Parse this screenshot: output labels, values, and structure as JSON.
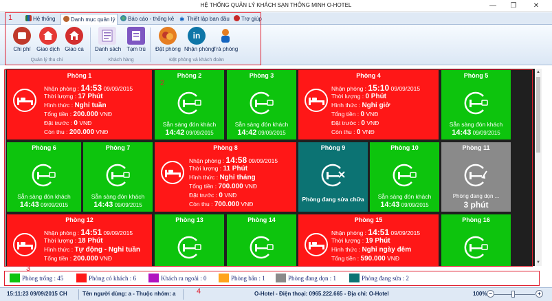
{
  "window": {
    "title": "HỆ THỐNG QUẢN LÝ KHÁCH SẠN THÔNG MINH O-HOTEL",
    "min_glyph": "—",
    "max_glyph": "❐",
    "close_glyph": "✕"
  },
  "ribbon": {
    "tabs": [
      {
        "label": "Hệ thống",
        "icon": "chart-icon",
        "color": "#c0392b"
      },
      {
        "label": "Danh mục quản lý",
        "icon": "user-icon",
        "color": "#b8632e",
        "active": true
      },
      {
        "label": "Báo cáo - thống kê",
        "icon": "globe-icon",
        "color": "#2e7d32"
      },
      {
        "label": "Thiết lập ban đầu",
        "icon": "gear-icon",
        "color": "#1565c0"
      },
      {
        "label": "Trợ giúp",
        "icon": "help-icon",
        "color": "#c62828"
      }
    ],
    "buttons": [
      {
        "label": "Chi phí",
        "icon": "expense-icon",
        "color": "#c0392b"
      },
      {
        "label": "Giao dịch",
        "icon": "transaction-icon",
        "color": "#e53935"
      },
      {
        "label": "Giao ca",
        "icon": "shift-icon",
        "color": "#d32f2f"
      },
      {
        "label": "Danh sách",
        "icon": "list-icon",
        "color": "#8e6bbf"
      },
      {
        "label": "Tạm trú",
        "icon": "residence-icon",
        "color": "#7e57c2"
      },
      {
        "label": "Đặt phòng",
        "icon": "booking-icon",
        "color": "#e67e22"
      },
      {
        "label": "Nhận phòng",
        "icon": "checkin-icon",
        "color": "#0e76a8"
      },
      {
        "label": "Trả phòng",
        "icon": "checkout-icon",
        "color": "#e67e22"
      }
    ],
    "groups": [
      "Quản lý thu chi",
      "Khách hàng",
      "Đặt phòng và khách đoàn"
    ]
  },
  "labels": {
    "checkin": "Nhận phòng :",
    "duration": "Thời lượng :",
    "form": "Hình thức :",
    "total": "Tổng tiền :",
    "prepaid": "Đặt trước :",
    "remaining": "Còn thu :",
    "ready": "Sẵn sàng đón khách",
    "repairing": "Phòng đang sửa chữa",
    "cleaning": "Phòng đang dọn ..."
  },
  "rooms": {
    "r1": {
      "name": "Phòng 1",
      "time": "14:53",
      "date": "09/09/2015",
      "duration": "17 Phút",
      "form": "Nghỉ tuần",
      "total": "200.000",
      "prepaid": "0",
      "remaining": "200.000",
      "currency": "VNĐ"
    },
    "r2": {
      "name": "Phòng 2",
      "time": "14:42",
      "date": "09/09/2015"
    },
    "r3": {
      "name": "Phòng 3",
      "time": "14:42",
      "date": "09/09/2015"
    },
    "r4": {
      "name": "Phòng 4",
      "time": "15:10",
      "date": "09/09/2015",
      "duration": "0 Phút",
      "form": "Nghỉ giờ",
      "total": "0",
      "prepaid": "0",
      "remaining": "0",
      "currency": "VNĐ"
    },
    "r5": {
      "name": "Phòng 5",
      "time": "14:43",
      "date": "09/09/2015"
    },
    "r6": {
      "name": "Phòng 6",
      "time": "14:43",
      "date": "09/09/2015"
    },
    "r7": {
      "name": "Phòng 7",
      "time": "14:43",
      "date": "09/09/2015"
    },
    "r8": {
      "name": "Phòng 8",
      "time": "14:58",
      "date": "09/09/2015",
      "duration": "11 Phút",
      "form": "Nghỉ tháng",
      "total": "700.000",
      "prepaid": "0",
      "remaining": "700.000",
      "currency": "VNĐ"
    },
    "r9": {
      "name": "Phòng 9"
    },
    "r10": {
      "name": "Phòng 10",
      "time": "14:43",
      "date": "09/09/2015"
    },
    "r11": {
      "name": "Phòng 11",
      "elapsed": "3 phút"
    },
    "r12": {
      "name": "Phòng 12",
      "time": "14:51",
      "date": "09/09/2015",
      "duration": "18 Phút",
      "form": "Tự động - Nghỉ tuần",
      "total": "200.000",
      "currency": "VNĐ"
    },
    "r13": {
      "name": "Phòng 13"
    },
    "r14": {
      "name": "Phòng 14"
    },
    "r15": {
      "name": "Phòng 15",
      "time": "14:51",
      "date": "09/09/2015",
      "duration": "19 Phút",
      "form": "Nghỉ ngày đêm",
      "total": "590.000",
      "currency": "VNĐ"
    },
    "r16": {
      "name": "Phòng 16"
    }
  },
  "legend": [
    {
      "label": "Phòng trống : 45",
      "color": "#0dc40d"
    },
    {
      "label": "Phòng có khách : 6",
      "color": "#ff1717"
    },
    {
      "label": "Khách ra ngoài : 0",
      "color": "#b012c0"
    },
    {
      "label": "Phòng bẩn : 1",
      "color": "#ffa41c"
    },
    {
      "label": "Phòng đang dọn : 1",
      "color": "#8a8a8a"
    },
    {
      "label": "Phòng đang sửa : 2",
      "color": "#0c7373"
    }
  ],
  "status": {
    "datetime": "15:11:23 09/09/2015 CH",
    "user": "Tên người dùng: a - Thuộc nhóm: a",
    "company": "O-Hotel - Điện thoại: 0965.222.665 - Địa chỉ: O-Hotel",
    "zoom": "100%",
    "zoom_minus": "−",
    "zoom_plus": "+"
  },
  "annotations": [
    "1",
    "2",
    "3",
    "4"
  ]
}
